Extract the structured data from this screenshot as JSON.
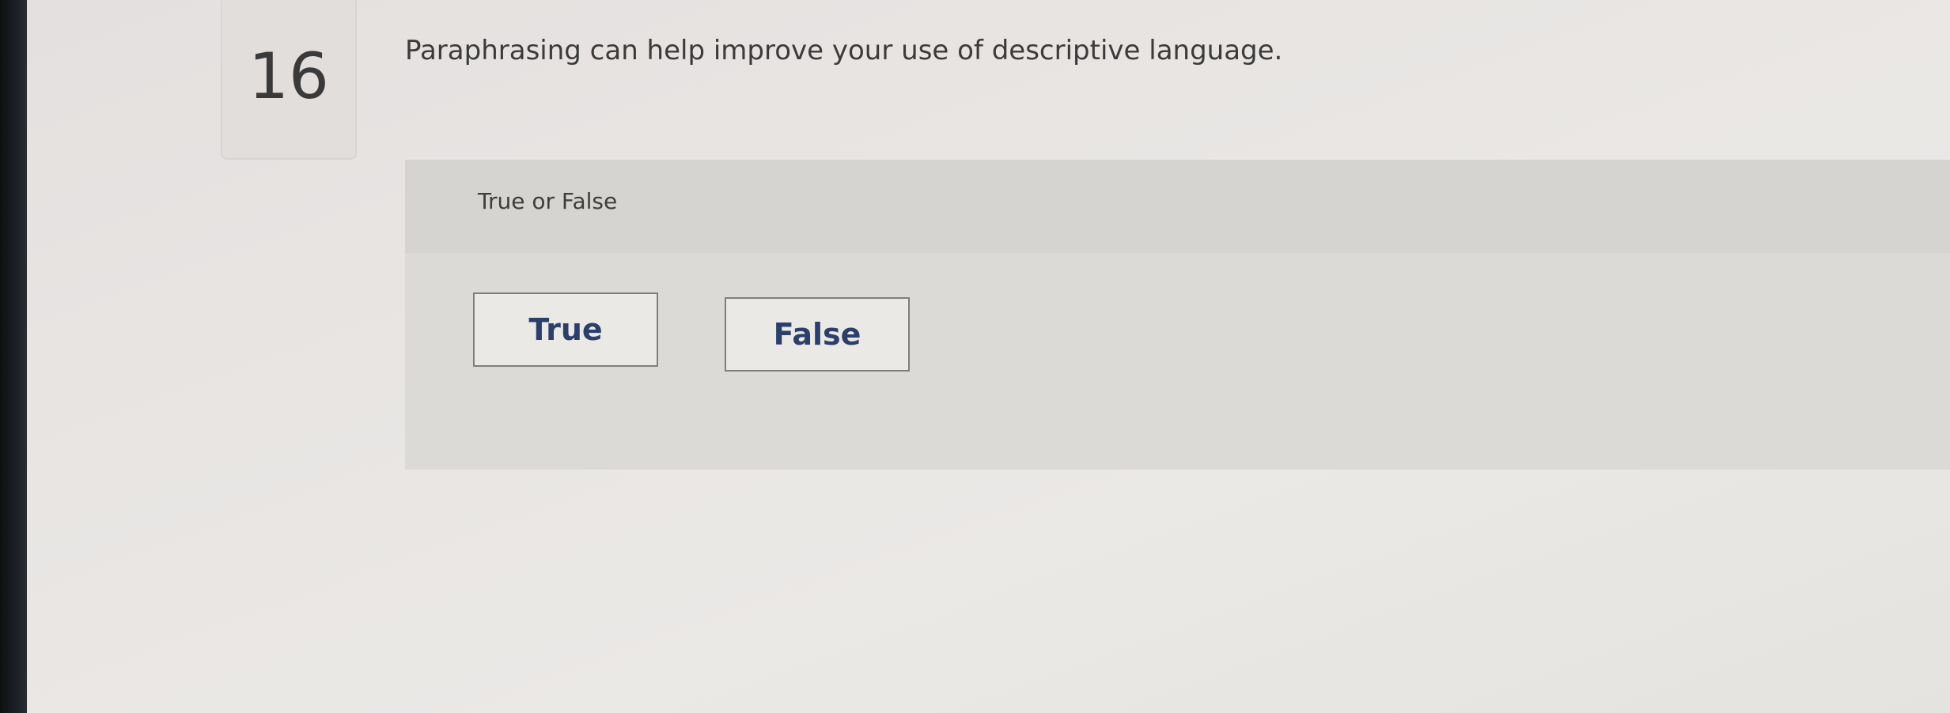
{
  "question": {
    "number": "16",
    "text": "Paraphrasing can help improve your use of descriptive language."
  },
  "answer": {
    "prompt": "True or False",
    "choices": [
      {
        "label": "True"
      },
      {
        "label": "False"
      }
    ]
  }
}
